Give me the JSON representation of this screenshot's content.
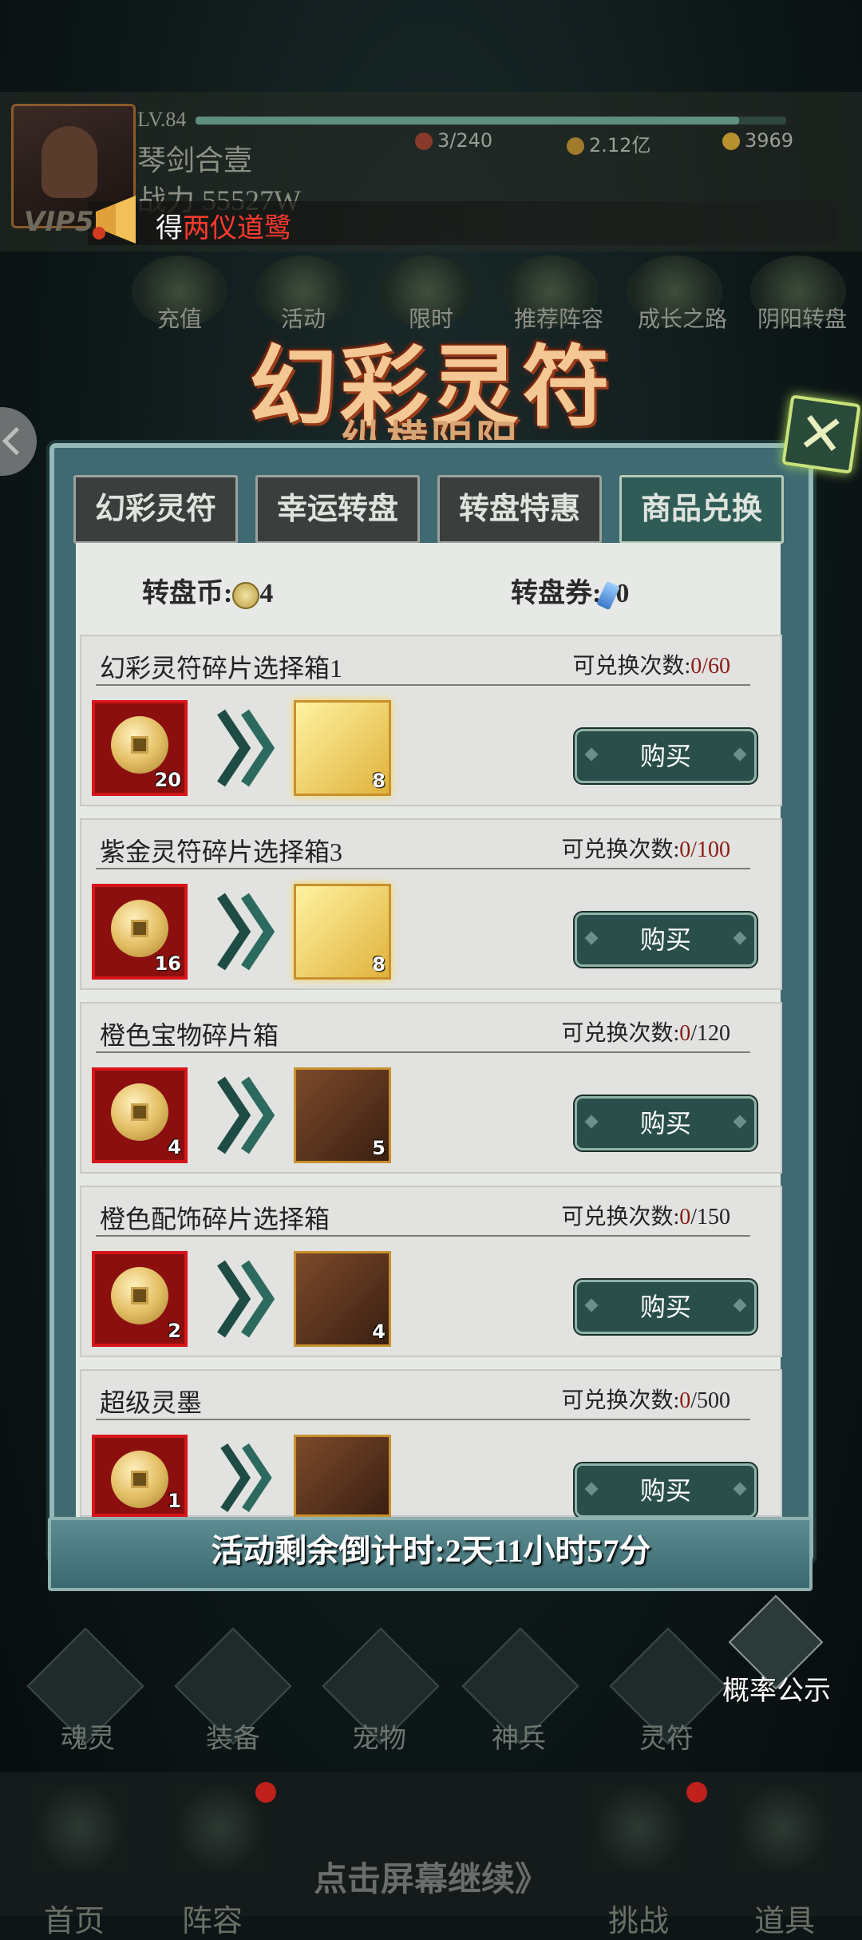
{
  "player": {
    "level": "LV.84",
    "name": "琴剑合壹",
    "power": "战力 55527W",
    "vip": "VIP5"
  },
  "resources": [
    {
      "icon": "stamina-icon",
      "value": "3/240"
    },
    {
      "icon": "copper-coin-icon",
      "value": "2.12亿"
    },
    {
      "icon": "gold-ingot-icon",
      "value": "3969"
    }
  ],
  "notice": {
    "prefix": "得",
    "highlight": "两仪道鹭"
  },
  "top_menu": [
    "充值",
    "活动",
    "限时",
    "推荐阵容",
    "成长之路",
    "阴阳转盘"
  ],
  "event": {
    "title": "幻彩灵符",
    "subtitle": "纵横阴阳"
  },
  "tabs": [
    "幻彩灵符",
    "幸运转盘",
    "转盘特惠",
    "商品兑换"
  ],
  "active_tab": 3,
  "currency": {
    "coin_label": "转盘币:",
    "coin_value": "4",
    "ticket_label": "转盘券:",
    "ticket_value": "0"
  },
  "exchange_label": "可兑换次数:",
  "items": [
    {
      "title": "幻彩灵符碎片选择箱1",
      "count": "0",
      "limit": "/60",
      "cost": "20",
      "reward_qty": "8",
      "buy": "购买"
    },
    {
      "title": "紫金灵符碎片选择箱3",
      "count": "0",
      "limit": "/100",
      "cost": "16",
      "reward_qty": "8",
      "buy": "购买"
    },
    {
      "title": "橙色宝物碎片箱",
      "count": "0",
      "limit": "/120",
      "cost": "4",
      "reward_qty": "5",
      "buy": "购买"
    },
    {
      "title": "橙色配饰碎片选择箱",
      "count": "0",
      "limit": "/150",
      "cost": "2",
      "reward_qty": "4",
      "buy": "购买"
    },
    {
      "title": "超级灵墨",
      "count": "0",
      "limit": "/500",
      "cost": "1",
      "reward_qty": "",
      "buy": "购买"
    }
  ],
  "timer": "活动剩余倒计时:2天11小时57分",
  "probability": "概率公示",
  "nav": [
    "魂灵",
    "装备",
    "宠物",
    "神兵",
    "灵符"
  ],
  "bottom_nav": [
    "首页",
    "阵容",
    "挑战",
    "道具"
  ],
  "continue_hint": "点击屏幕继续》",
  "colors": {
    "panel": "#3f6a72",
    "accent_red": "#d5151a",
    "count_red": "#8a1b17",
    "button": "#2a4e49"
  }
}
